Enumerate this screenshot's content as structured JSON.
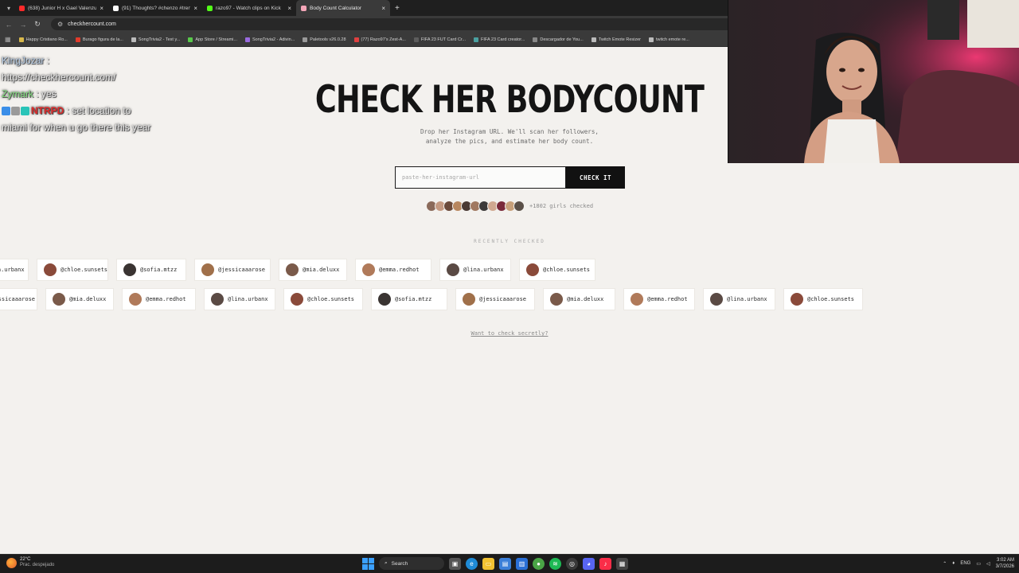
{
  "browser": {
    "tabs": [
      {
        "title": "(638) Junior H x Gael Valenzuela",
        "favicon_color": "#ff2a2a",
        "active": false
      },
      {
        "title": "(91) Thoughts? #chenzo #trend",
        "favicon_color": "#ffffff",
        "active": false
      },
      {
        "title": "razo97 - Watch clips on Kick",
        "favicon_color": "#53fc18",
        "active": false
      },
      {
        "title": "Body Count Calculator",
        "favicon_color": "#f4a6b8",
        "active": true
      }
    ],
    "address": "checkhercount.com",
    "bookmarks": [
      {
        "label": "Happy Cristiano Ro...",
        "color": "#d8b84a"
      },
      {
        "label": "Burago figura de la...",
        "color": "#e23b2b"
      },
      {
        "label": "SongTrivia2 - Test y...",
        "color": "#bbbbbb"
      },
      {
        "label": "App Store / Streami...",
        "color": "#58c94a"
      },
      {
        "label": "SongTrivia2 - Adivin...",
        "color": "#9a6be0"
      },
      {
        "label": "Paletools v26.0.28",
        "color": "#9a9a9a"
      },
      {
        "label": "(77) Razo97's Zest-A...",
        "color": "#e04040"
      },
      {
        "label": "FIFA 23 FUT Card Cr...",
        "color": "#5c5c5c"
      },
      {
        "label": "FIFA 23 Card creator...",
        "color": "#4aa0a0"
      },
      {
        "label": "Descargador de You...",
        "color": "#888888"
      },
      {
        "label": "Twitch Emote Resizer",
        "color": "#bbbbbb"
      },
      {
        "label": "twitch emote re...",
        "color": "#bbbbbb"
      }
    ]
  },
  "page": {
    "title": "CHECK HER BODYCOUNT",
    "subtitle": "Drop her Instagram URL. We'll scan her followers,\nanalyze the pics, and estimate her body count.",
    "input_placeholder": "paste-her-instagram-url",
    "check_button": "CHECK IT",
    "checked_count": "+1802 girls checked",
    "recent_label": "RECENTLY CHECKED",
    "secret_link": "Want to check secretly?",
    "avatar_colors": [
      "#8a6a5a",
      "#c49a82",
      "#6b4a3a",
      "#b8875f",
      "#4a3a34",
      "#a07860",
      "#3d3a3a",
      "#d0a890",
      "#7a2a3a",
      "#c7a07a",
      "#5a5048"
    ],
    "recent_row1": [
      {
        "handle": "@lina.urbanx",
        "color": "#5a4a44"
      },
      {
        "handle": "@chloe.sunsets",
        "color": "#8a4a3a"
      },
      {
        "handle": "@sofia.mtzz",
        "color": "#3a3432"
      },
      {
        "handle": "@jessicaaarose",
        "color": "#a0704a"
      },
      {
        "handle": "@mia.deluxx",
        "color": "#7a5a4a"
      },
      {
        "handle": "@emma.redhot",
        "color": "#b07a5a"
      },
      {
        "handle": "@lina.urbanx",
        "color": "#5a4a44"
      },
      {
        "handle": "@chloe.sunsets",
        "color": "#8a4a3a"
      }
    ],
    "recent_row2": [
      {
        "handle": "@jessicaaarose",
        "color": "#a0704a"
      },
      {
        "handle": "@mia.deluxx",
        "color": "#7a5a4a"
      },
      {
        "handle": "@emma.redhot",
        "color": "#b07a5a"
      },
      {
        "handle": "@lina.urbanx",
        "color": "#5a4a44"
      },
      {
        "handle": "@chloe.sunsets",
        "color": "#8a4a3a"
      },
      {
        "handle": "@sofia.mtzz",
        "color": "#3a3432"
      },
      {
        "handle": "@jessicaaarose",
        "color": "#a0704a"
      },
      {
        "handle": "@mia.deluxx",
        "color": "#7a5a4a"
      },
      {
        "handle": "@emma.redhot",
        "color": "#b07a5a"
      },
      {
        "handle": "@lina.urbanx",
        "color": "#5a4a44"
      },
      {
        "handle": "@chloe.sunsets",
        "color": "#8a4a3a"
      }
    ]
  },
  "chat": [
    {
      "user": "KingJozar",
      "sep": " :",
      "message": "",
      "user_color": "#b9cfe8"
    },
    {
      "user": "",
      "sep": "",
      "message": "https://checkhercount.com/",
      "user_color": "#e8e8e8"
    },
    {
      "user": "Zymark",
      "sep": " : ",
      "message": "yes",
      "user_color": "#7edb7a"
    },
    {
      "user": "NTRPD",
      "sep": " : ",
      "message": "set location to",
      "user_color": "#e02a2a",
      "badges": true
    },
    {
      "user": "",
      "sep": "",
      "message": "miami for when u go there this year",
      "user_color": "#e8e8e8"
    }
  ],
  "taskbar": {
    "temperature": "22°C",
    "weather": "Prac. despejado",
    "search": "Search",
    "lang": "ENG",
    "time": "3:02 AM",
    "date": "3/7/2026"
  }
}
